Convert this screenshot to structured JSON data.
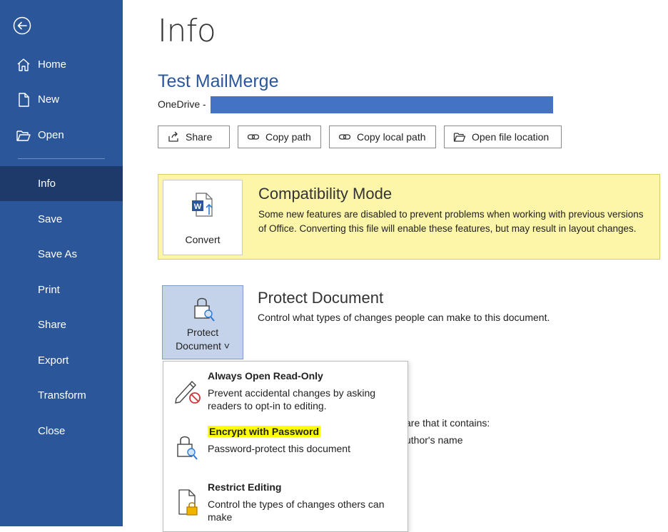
{
  "sidebar": {
    "back_icon": "back-arrow-icon",
    "items": [
      {
        "label": "Home",
        "icon": "home-icon"
      },
      {
        "label": "New",
        "icon": "new-document-icon"
      },
      {
        "label": "Open",
        "icon": "open-folder-icon"
      },
      {
        "label": "Info"
      },
      {
        "label": "Save"
      },
      {
        "label": "Save As"
      },
      {
        "label": "Print"
      },
      {
        "label": "Share"
      },
      {
        "label": "Export"
      },
      {
        "label": "Transform"
      },
      {
        "label": "Close"
      }
    ],
    "active": "Info"
  },
  "main": {
    "page_title": "Info",
    "doc_title": "Test MailMerge",
    "location_prefix": "OneDrive -",
    "actions": [
      {
        "label": "Share",
        "icon": "share-icon"
      },
      {
        "label": "Copy path",
        "icon": "link-icon"
      },
      {
        "label": "Copy local path",
        "icon": "link-icon"
      },
      {
        "label": "Open file location",
        "icon": "folder-icon"
      }
    ],
    "compat": {
      "button_label": "Convert",
      "title": "Compatibility Mode",
      "description": "Some new features are disabled to prevent problems when working with previous versions of Office. Converting this file will enable these features, but may result in layout changes."
    },
    "protect": {
      "button_line1": "Protect",
      "button_line2": "Document ˅",
      "title": "Protect Document",
      "description": "Control what types of changes people can make to this document."
    },
    "background_text": [
      "are that it contains:",
      "uthor's name"
    ]
  },
  "menu": {
    "items": [
      {
        "title": "Always Open Read-Only",
        "description": "Prevent accidental changes by asking readers to opt-in to editing.",
        "icon": "read-only-pencil-icon"
      },
      {
        "title": "Encrypt with Password",
        "description": "Password-protect this document",
        "icon": "lock-key-icon",
        "highlighted": true
      },
      {
        "title": "Restrict Editing",
        "description": "Control the types of changes others can make",
        "icon": "restrict-editing-icon"
      }
    ]
  },
  "colors": {
    "sidebar_bg": "#2b579a",
    "sidebar_active": "#1d3a6b",
    "compat_bg": "#fdf5a8",
    "highlight": "#ffff00",
    "redaction": "#4472c4"
  }
}
